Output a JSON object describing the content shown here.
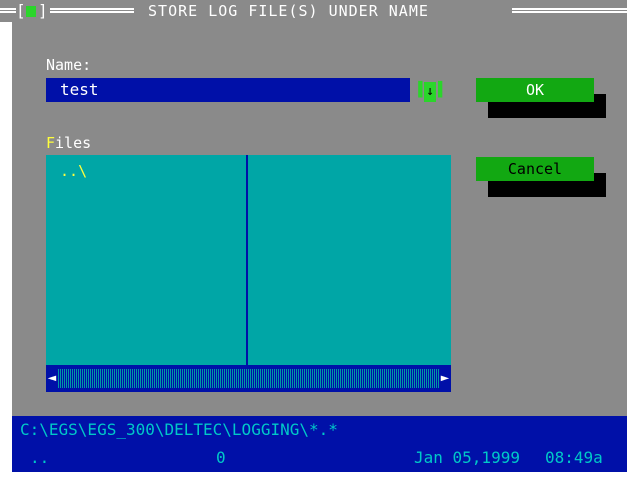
{
  "window": {
    "title": " STORE LOG FILE(S) UNDER NAME ",
    "close_glyph_left": "[",
    "close_glyph_right": "]"
  },
  "name_field": {
    "label_prefix": "",
    "label": "Name:",
    "value": "test",
    "history_icon": "down-arrow-icon",
    "history_glyph": "↓"
  },
  "files": {
    "label_hot": "F",
    "label_rest": "iles",
    "entries": [
      ".."
    ]
  },
  "buttons": {
    "ok": "OK",
    "cancel": "Cancel"
  },
  "scrollbar": {
    "left_arrow": "◄",
    "right_arrow": "►"
  },
  "status": {
    "path": "C:\\EGS\\EGS_300\\DELTEC\\LOGGING\\*.*",
    "name": "..",
    "size": "0",
    "date": "Jan 05,1999",
    "time": "08:49a"
  },
  "colors": {
    "panel_gray": "#8a8a8a",
    "input_blue": "#0010a8",
    "button_green": "#12a812",
    "list_cyan": "#00a6a6",
    "hotkey_yellow": "#ffff3c"
  }
}
